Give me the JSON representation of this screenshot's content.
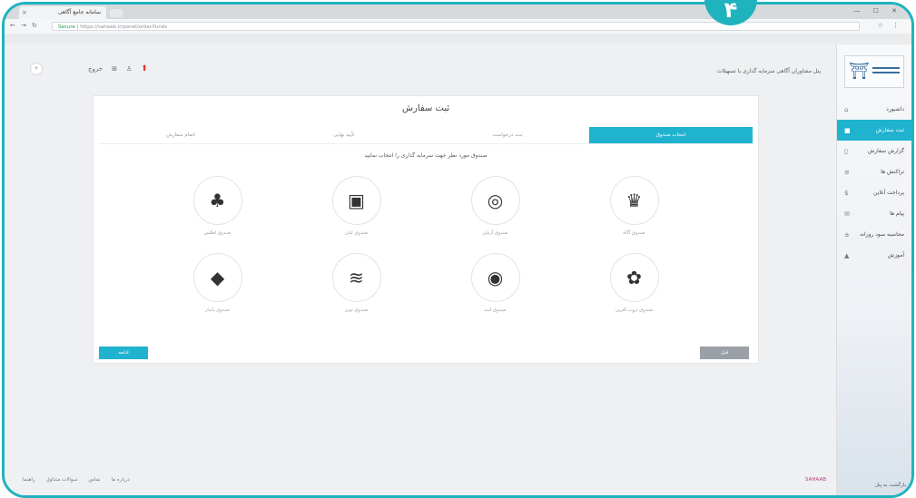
{
  "badge": {
    "number": "۴"
  },
  "browser": {
    "tab_title": "سامانه جامع آگاهی",
    "tab_close": "×",
    "url_secure": "Secure",
    "url": "https://sahaab.ir/panel/order/funds"
  },
  "topbar": {
    "title": "پنل مشاوران آگاهی سرمایه گذاری با تسهیلات",
    "user_label": "خروج"
  },
  "sidebar": {
    "items": [
      {
        "label": "داشبورد",
        "icon": "home-icon"
      },
      {
        "label": "ثبت سفارش",
        "icon": "cart-icon",
        "active": true
      },
      {
        "label": "گزارش سفارش",
        "icon": "doc-icon"
      },
      {
        "label": "تراکنش ها",
        "icon": "list-icon"
      },
      {
        "label": "پرداخت آنلاین",
        "icon": "card-icon"
      },
      {
        "label": "پیام ها",
        "icon": "mail-icon"
      },
      {
        "label": "محاسبه سود روزانه",
        "icon": "calc-icon"
      },
      {
        "label": "آموزش",
        "icon": "book-icon"
      }
    ],
    "footer": "بازگشت به پنل"
  },
  "card": {
    "title": "ثبت سفارش",
    "steps": [
      "انتخاب صندوق",
      "ثبت درخواست",
      "تأیید نهایی",
      "اتمام سفارش"
    ],
    "instruction": "صندوق مورد نظر جهت سرمایه گذاری را انتخاب نمایید",
    "funds": [
      {
        "name": "صندوق آگاه",
        "glyph": "♛"
      },
      {
        "name": "صندوق آرمان",
        "glyph": "◎"
      },
      {
        "name": "صندوق کیان",
        "glyph": "▣"
      },
      {
        "name": "صندوق اطلس",
        "glyph": "♣"
      },
      {
        "name": "صندوق ثروت آفرین",
        "glyph": "✿"
      },
      {
        "name": "صندوق امید",
        "glyph": "◉"
      },
      {
        "name": "صندوق نوین",
        "glyph": "≋"
      },
      {
        "name": "صندوق پایدار",
        "glyph": "◆"
      }
    ],
    "next_label": "ادامه",
    "prev_label": "قبل"
  },
  "footer": {
    "links": [
      "درباره ما",
      "تماس",
      "سوالات متداول",
      "راهنما"
    ],
    "brand": "SAHAAB"
  }
}
